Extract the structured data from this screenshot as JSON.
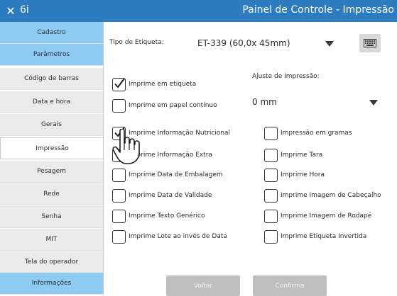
{
  "window": {
    "close_glyph": "✕",
    "app_id": "6i",
    "title": "Painel de Controle - Impressão"
  },
  "sidebar": {
    "items": [
      {
        "label": "Cadastro",
        "kind": "group"
      },
      {
        "label": "Parâmetros",
        "kind": "group"
      },
      {
        "label": "Código de barras",
        "kind": "sub"
      },
      {
        "label": "Data e hora",
        "kind": "sub"
      },
      {
        "label": "Gerais",
        "kind": "sub"
      },
      {
        "label": "Impressão",
        "kind": "active"
      },
      {
        "label": "Pesagem",
        "kind": "sub"
      },
      {
        "label": "Rede",
        "kind": "sub"
      },
      {
        "label": "Senha",
        "kind": "sub"
      },
      {
        "label": "MIT",
        "kind": "sub"
      },
      {
        "label": "Tela do operador",
        "kind": "sub"
      },
      {
        "label": "Informações",
        "kind": "group"
      }
    ]
  },
  "form": {
    "label_type_label": "Tipo de Etiqueta:",
    "label_type_value": "ET-339 (60,0x  45mm)",
    "print_adjust_label": "Ajuste de Impressão:",
    "print_adjust_value": "0 mm",
    "print_on_label": "Imprime em etiqueta",
    "print_on_label_checked": true,
    "print_continuous": "Imprime em papel contínuo",
    "print_continuous_checked": false
  },
  "options_left": [
    {
      "label": "Imprime Informação Nutricional",
      "checked": true
    },
    {
      "label": "Imprime Informação Extra",
      "checked": false
    },
    {
      "label": "Imprime Data de Embalagem",
      "checked": false
    },
    {
      "label": "Imprime Data de Validade",
      "checked": false
    },
    {
      "label": "Imprime Texto Genérico",
      "checked": false
    },
    {
      "label": "Imprime Lote ao invés de Data",
      "checked": false
    }
  ],
  "options_right": [
    {
      "label": "Impressão em gramas",
      "checked": false
    },
    {
      "label": "Imprime Tara",
      "checked": false
    },
    {
      "label": "Imprime Hora",
      "checked": false
    },
    {
      "label": "Imprime Imagem de Cabeçalho",
      "checked": false
    },
    {
      "label": "Imprime Imagem de Rodapé",
      "checked": false
    },
    {
      "label": "Imprime Etiqueta Invertida",
      "checked": false
    }
  ],
  "footer": {
    "back_label": "Voltar",
    "confirm_label": "Confirma"
  },
  "icons": {
    "close": "close-icon",
    "keyboard": "keyboard-icon",
    "dropdown": "chevron-down-icon",
    "cursor": "hand-pointer-icon"
  },
  "colors": {
    "titlebar": "#2c7cbf",
    "nav_group": "#8ecbf3",
    "nav_sub": "#ebebeb",
    "button_disabled": "#bfbfbf"
  }
}
